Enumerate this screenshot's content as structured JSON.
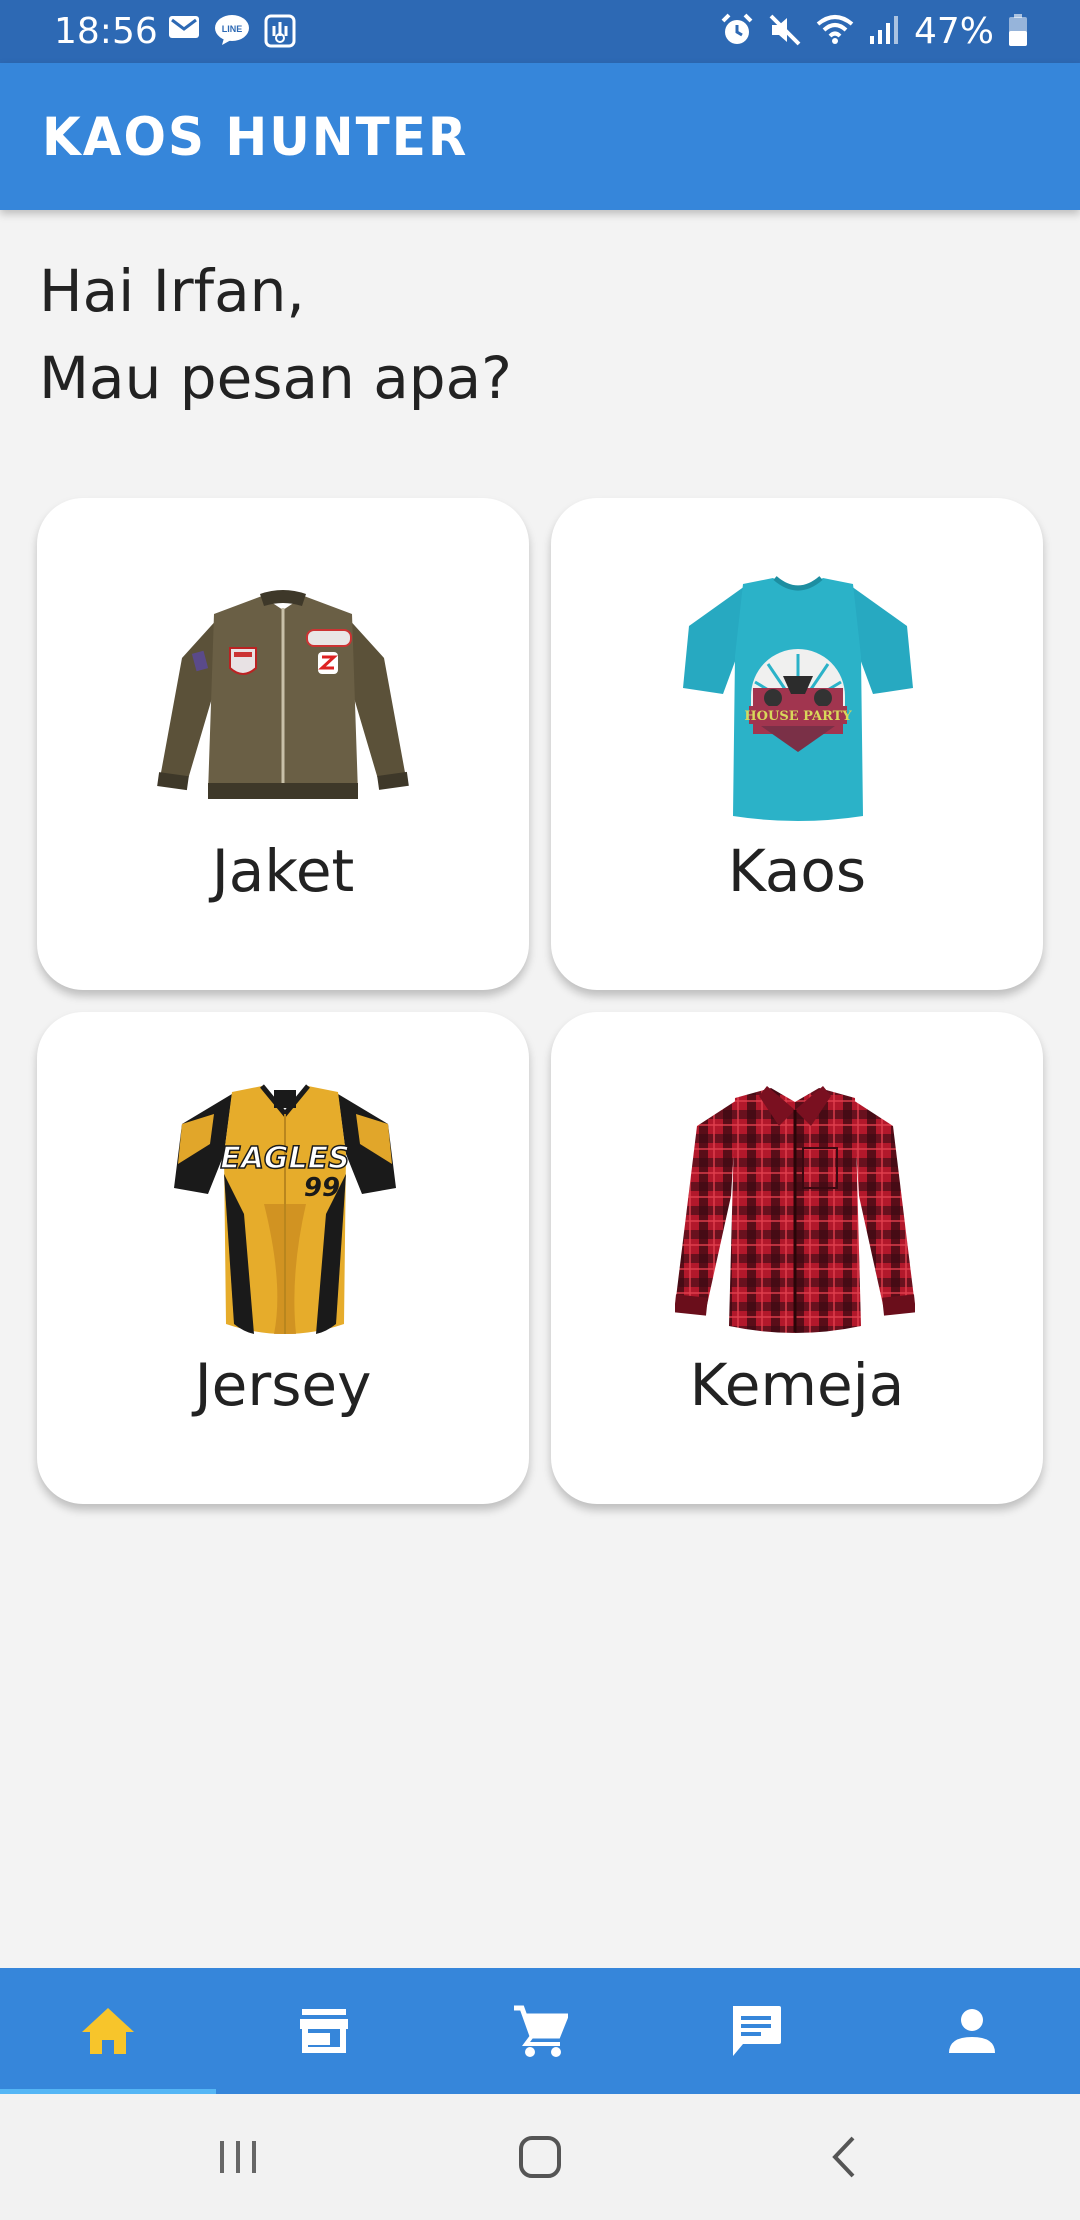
{
  "status_bar": {
    "time": "18:56",
    "battery": "47%",
    "left_icons": [
      "gmail-icon",
      "line-icon",
      "app-notification-icon"
    ],
    "right_icons": [
      "alarm-icon",
      "mute-icon",
      "wifi-icon",
      "signal-icon",
      "battery-icon"
    ]
  },
  "app_bar": {
    "title": "KAOS HUNTER"
  },
  "greeting": {
    "line1": "Hai Irfan,",
    "line2": "Mau pesan apa?"
  },
  "categories": [
    {
      "label": "Jaket",
      "icon": "jacket-image"
    },
    {
      "label": "Kaos",
      "icon": "tshirt-image",
      "graphic_text": "HOUSE PARTY"
    },
    {
      "label": "Jersey",
      "icon": "jersey-image",
      "graphic_text": "EAGLES",
      "number": "99"
    },
    {
      "label": "Kemeja",
      "icon": "flannel-shirt-image"
    }
  ],
  "bottom_nav": {
    "items": [
      "home-icon",
      "store-icon",
      "cart-icon",
      "chat-icon",
      "profile-icon"
    ],
    "active_index": 0,
    "active_color": "#f7c52b",
    "color": "#ffffff"
  },
  "colors": {
    "status_bar": "#2d69b4",
    "app_bar": "#3686da",
    "background": "#f3f3f3",
    "card": "#ffffff"
  }
}
